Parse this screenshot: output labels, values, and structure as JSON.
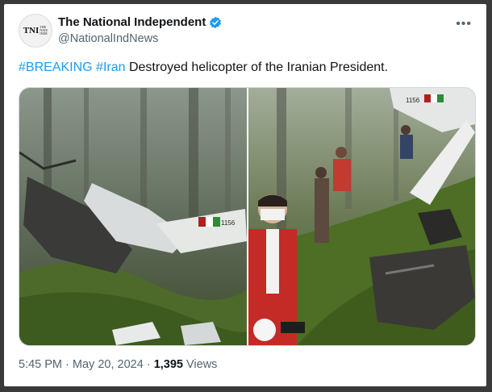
{
  "account": {
    "avatar_text": "TNI",
    "avatar_subtext": "THE NATIONAL INDEPENDENT",
    "display_name": "The National Independent",
    "handle": "@NationalIndNews",
    "verified_icon": "verified-badge-icon",
    "more_icon": "more-options-icon",
    "more_glyph": "•••"
  },
  "tweet": {
    "hashtag_1": "#BREAKING",
    "hashtag_2": "#Iran",
    "body": "Destroyed helicopter of the Iranian President."
  },
  "media": {
    "photo_left": "helicopter-wreckage-photo",
    "photo_right": "rescue-workers-wreckage-photo",
    "tail_number_left": "1156",
    "tail_number_right": "1156"
  },
  "footer": {
    "time": "5:45 PM",
    "separator": "·",
    "date": "May 20, 2024",
    "views_count": "1,395",
    "views_label": "Views"
  },
  "colors": {
    "link": "#1d9bf0",
    "text": "#0f1419",
    "muted": "#536471",
    "verified": "#1d9bf0"
  }
}
